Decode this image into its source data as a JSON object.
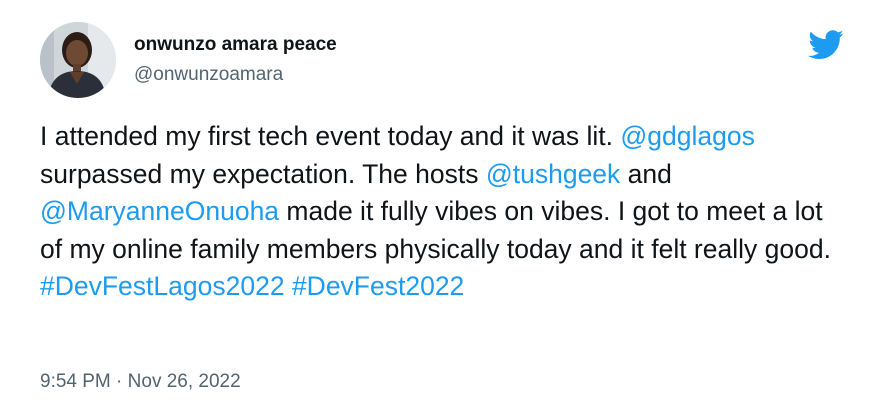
{
  "author": {
    "display_name": "onwunzo amara peace",
    "handle": "@onwunzoamara"
  },
  "icons": {
    "brand": "twitter-bird-icon",
    "avatar": "profile-photo"
  },
  "colors": {
    "link": "#1d9bf0",
    "text": "#0f1419",
    "muted": "#536471",
    "brand": "#1d9bf0"
  },
  "tweet": {
    "segments": {
      "s1": "I attended my first tech event today and it was lit. ",
      "m1": "@gdglagos",
      "s2": " surpassed my expectation. The hosts ",
      "m2": "@tushgeek",
      "s3": " and ",
      "m3": "@MaryanneOnuoha",
      "s4": " made it fully vibes on vibes. I got to meet a lot of my online family members physically today and it felt really good. ",
      "h1": "#DevFestLagos2022",
      "s5": " ",
      "h2": "#DevFest2022"
    },
    "time": "9:54 PM",
    "separator": "·",
    "date": "Nov 26, 2022"
  }
}
